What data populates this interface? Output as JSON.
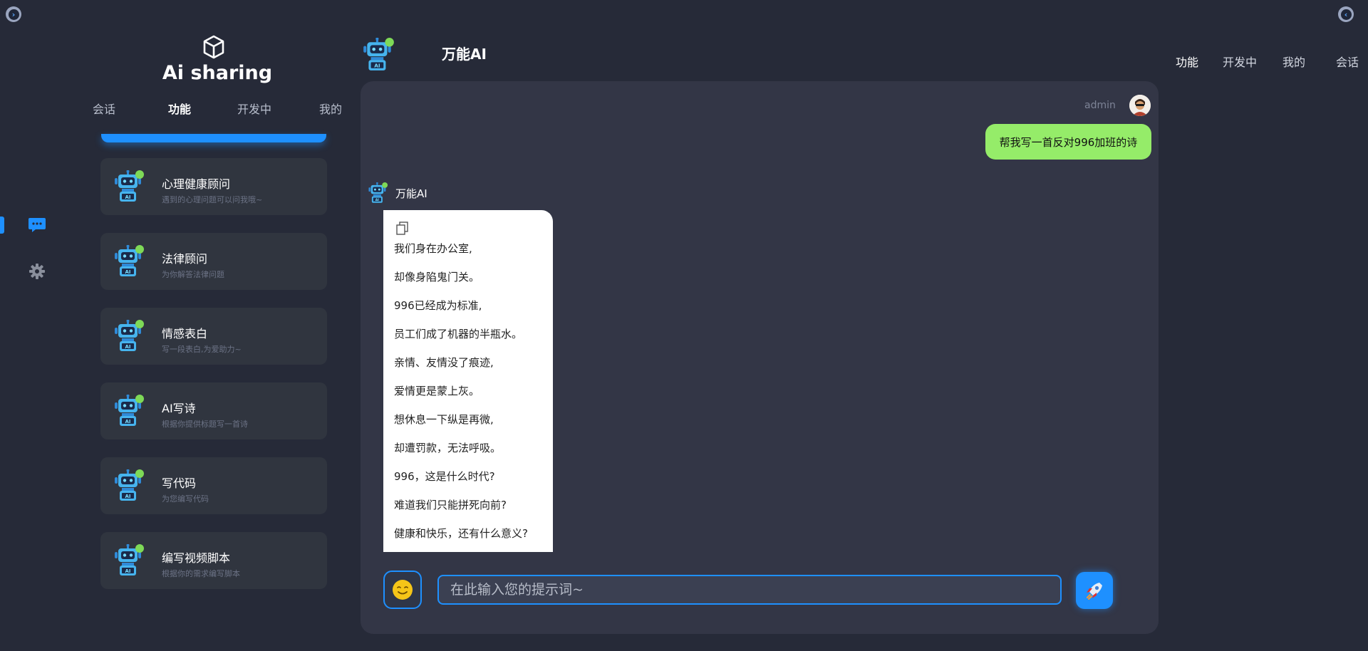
{
  "brand": {
    "title": "Ai sharing"
  },
  "left_tabs": [
    {
      "label": "会话",
      "active": false
    },
    {
      "label": "功能",
      "active": true
    },
    {
      "label": "开发中",
      "active": false
    },
    {
      "label": "我的",
      "active": false
    }
  ],
  "assistants": [
    {
      "title": "心理健康顾问",
      "subtitle": "遇到的心理问题可以问我哦~"
    },
    {
      "title": "法律顾问",
      "subtitle": "为你解答法律问题"
    },
    {
      "title": "情感表白",
      "subtitle": "写一段表白,为爱助力~"
    },
    {
      "title": "AI写诗",
      "subtitle": "根据你提供标题写一首诗"
    },
    {
      "title": "写代码",
      "subtitle": "为您编写代码"
    },
    {
      "title": "编写视频脚本",
      "subtitle": "根据你的需求编写脚本"
    }
  ],
  "chat": {
    "title": "万能AI",
    "user_name": "admin",
    "user_message": "帮我写一首反对996加班的诗",
    "ai_name": "万能AI",
    "ai_lines": [
      "我们身在办公室,",
      "却像身陷鬼门关。",
      "996已经成为标准,",
      "员工们成了机器的半瓶水。",
      "亲情、友情没了痕迹,",
      "爱情更是蒙上灰。",
      "想休息一下纵是再微,",
      "却遭罚款，无法呼吸。",
      "996，这是什么时代?",
      "难道我们只能拼死向前?",
      "健康和快乐，还有什么意义?"
    ],
    "input_placeholder": "在此输入您的提示词~"
  },
  "right_nav": [
    "功能",
    "开发中",
    "我的",
    "会话"
  ],
  "icons": {
    "corner_left": "chevron-right-icon",
    "corner_right": "chevron-left-icon",
    "rail_chat": "chat-bubble-icon",
    "rail_settings": "gear-icon",
    "brand_logo": "cube-icon",
    "copy": "copy-icon",
    "emoji": "smiley-emoji-icon",
    "send": "rocket-icon"
  },
  "colors": {
    "accent": "#1e90ff",
    "user_bubble": "#95ec69",
    "panel": "#333646",
    "background": "#262a38",
    "card": "#30353f"
  }
}
